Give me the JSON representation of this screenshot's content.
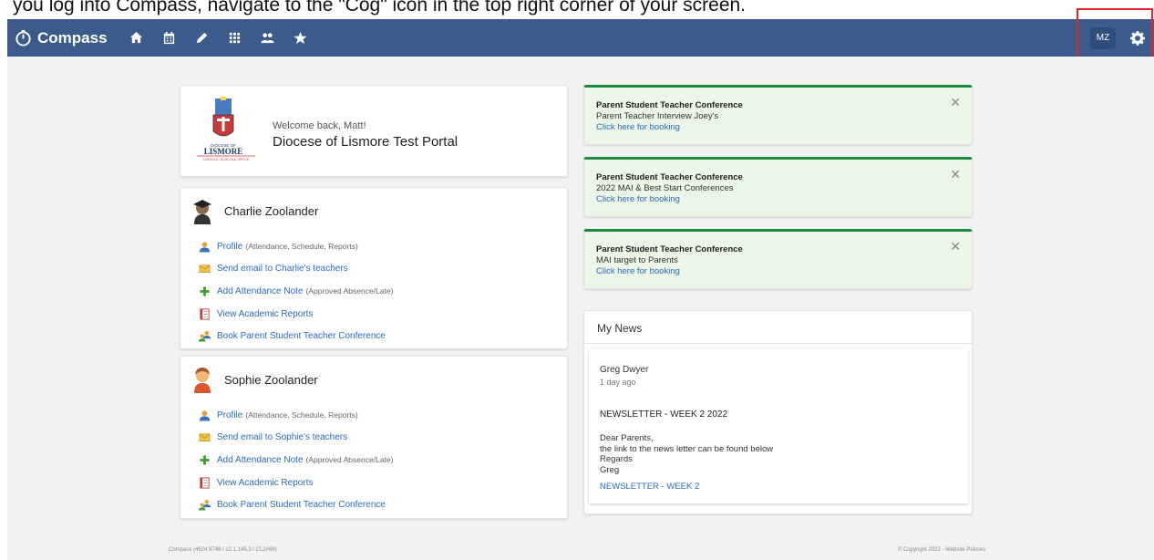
{
  "caption": "you log into Compass, navigate to the \"Cog\" icon in the top right corner of your screen.",
  "navbar": {
    "brand": "Compass",
    "icons": [
      "home-icon",
      "calendar-icon",
      "pencil-icon",
      "grid-icon",
      "people-icon",
      "star-icon"
    ],
    "user_initials": "MZ",
    "settings_icon": "gear-icon",
    "color": "#3b5b8c"
  },
  "welcome": {
    "logo_text_small": "DIOCESE OF",
    "logo_text_main": "LISMORE",
    "logo_text_sub": "CATHOLIC SCHOOLS OFFICE",
    "greeting": "Welcome back, Matt!",
    "portal": "Diocese of Lismore Test Portal"
  },
  "students": [
    {
      "name": "Charlie Zoolander",
      "links": [
        {
          "label": "Profile",
          "sub": "(Attendance, Schedule, Reports)",
          "icon": "profile-icon"
        },
        {
          "label": "Send email to Charlie's teachers",
          "sub": "",
          "icon": "envelope-icon"
        },
        {
          "label": "Add Attendance Note",
          "sub": "(Approved Absence/Late)",
          "icon": "plus-icon"
        },
        {
          "label": "View Academic Reports",
          "sub": "",
          "icon": "report-icon"
        },
        {
          "label": "Book Parent Student Teacher Conference",
          "sub": "",
          "icon": "conference-icon"
        }
      ]
    },
    {
      "name": "Sophie Zoolander",
      "links": [
        {
          "label": "Profile",
          "sub": "(Attendance, Schedule, Reports)",
          "icon": "profile-icon"
        },
        {
          "label": "Send email to Sophie's teachers",
          "sub": "",
          "icon": "envelope-icon"
        },
        {
          "label": "Add Attendance Note",
          "sub": "(Approved Absence/Late)",
          "icon": "plus-icon"
        },
        {
          "label": "View Academic Reports",
          "sub": "",
          "icon": "report-icon"
        },
        {
          "label": "Book Parent Student Teacher Conference",
          "sub": "",
          "icon": "conference-icon"
        }
      ]
    }
  ],
  "notices": [
    {
      "title": "Parent Student Teacher Conference",
      "body": "Parent Teacher Interview Joey's",
      "link": "Click here for booking"
    },
    {
      "title": "Parent Student Teacher Conference",
      "body": "2022 MAI & Best Start Conferences",
      "link": "Click here for booking"
    },
    {
      "title": "Parent Student Teacher Conference",
      "body": "MAI target to Parents",
      "link": "Click here for booking"
    }
  ],
  "news": {
    "title": "My News",
    "author": "Greg Dwyer",
    "time": "1 day ago",
    "headline": "NEWSLETTER - WEEK 2 2022",
    "body": [
      "Dear Parents,",
      "the link to the news letter can be found below",
      "Regards",
      "Greg"
    ],
    "link": "NEWSLETTER - WEEK 2"
  },
  "footer": {
    "left": "Compass (4624.9748 / 12.1.145.3 / CL2#68)",
    "right": "© Copyright 2022 - Website Policies"
  },
  "colors": {
    "accent_link": "#2a6ac2",
    "notice_bg": "#ebf6e6",
    "notice_border": "#1c8a3c",
    "highlight": "#e0252b"
  }
}
